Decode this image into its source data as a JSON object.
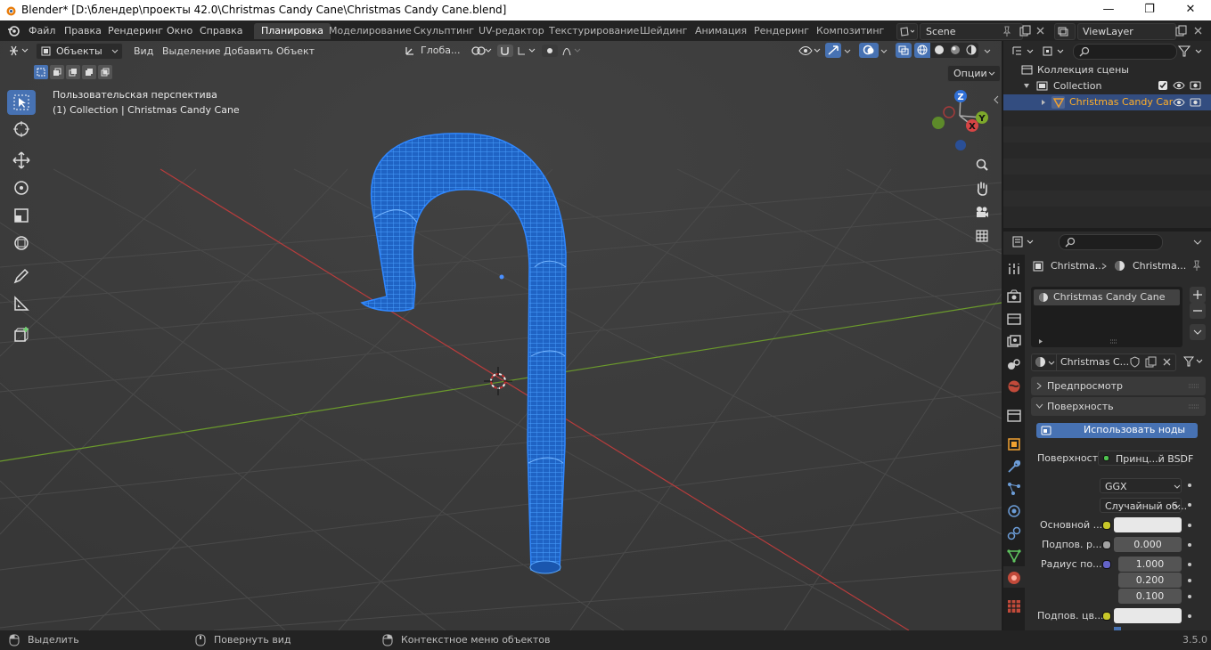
{
  "window": {
    "title": "Blender* [D:\\блендер\\проекты 42.0\\Christmas Candy Cane\\Christmas Candy Cane.blend]",
    "minimize": "—",
    "maximize": "❐",
    "close": "✕"
  },
  "menu": [
    "Файл",
    "Правка",
    "Рендеринг",
    "Окно",
    "Справка"
  ],
  "workspaces": [
    "Планировка",
    "Моделирование",
    "Скульптинг",
    "UV-редактор",
    "Текстурирование",
    "Шейдинг",
    "Анимация",
    "Рендеринг",
    "Композитинг"
  ],
  "active_workspace": "Планировка",
  "scene": {
    "name": "Scene",
    "view_layer": "ViewLayer"
  },
  "viewport": {
    "mode": "Объекты",
    "menus": [
      "Вид",
      "Выделение",
      "Добавить",
      "Объект"
    ],
    "transform": "Глоба...",
    "options": "Опции",
    "perspective": "Пользовательская перспектива",
    "collection_info": "(1) Collection | Christmas Candy Cane",
    "gizmo": {
      "z": "Z",
      "y": "Y",
      "x": "X"
    }
  },
  "outliner": {
    "root": "Коллекция сцены",
    "collection": "Collection",
    "object": "Christmas Candy Car"
  },
  "properties": {
    "breadcrumb": [
      "Christma...",
      "Christma..."
    ],
    "material_slot": "Christmas Candy Cane",
    "material_name": "Christmas C...",
    "panels": {
      "preview": "Предпросмотр",
      "surface": "Поверхность"
    },
    "use_nodes": "Использовать ноды",
    "surface_label": "Поверхность",
    "surface_value": "Принц...й BSDF",
    "distribution": "GGX",
    "subsurface_method": "Случайный об...",
    "rows": [
      {
        "label": "Основной ...",
        "value": ""
      },
      {
        "label": "Подпов. р...",
        "value": "0.000"
      },
      {
        "label": "Радиус по...",
        "value": "1.000"
      },
      {
        "label": "",
        "value": "0.200"
      },
      {
        "label": "",
        "value": "0.100"
      },
      {
        "label": "Подпов. цв...",
        "value": ""
      }
    ]
  },
  "status": {
    "select": "Выделить",
    "rotate": "Повернуть вид",
    "context": "Контекстное меню объектов",
    "version": "3.5.0"
  },
  "colors": {
    "accent": "#4772b3",
    "wire": "#2b78e0",
    "x_axis": "#b83c3c",
    "y_axis": "#6b9a2c"
  }
}
